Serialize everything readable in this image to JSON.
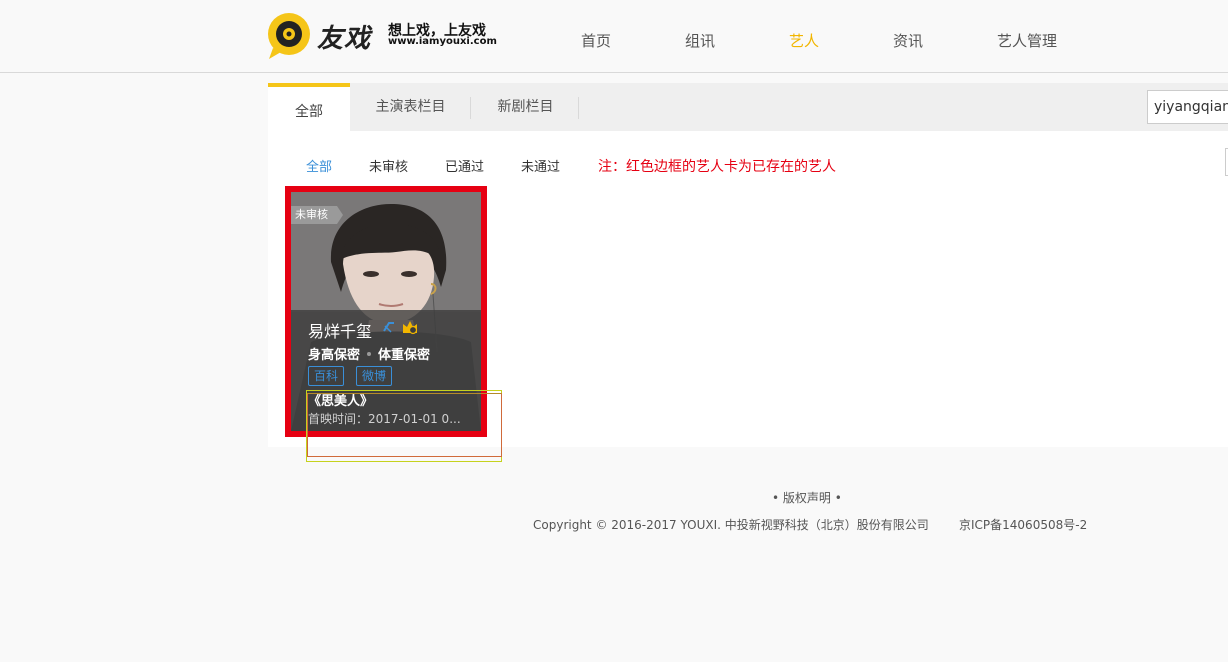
{
  "header": {
    "logo_text": "友戏",
    "logo_slogan": "想上戏，上友戏",
    "logo_url": "www.iamyouxi.com",
    "nav": [
      {
        "label": "首页"
      },
      {
        "label": "组讯"
      },
      {
        "label": "艺人",
        "active": true
      },
      {
        "label": "资讯"
      },
      {
        "label": "艺人管理"
      }
    ],
    "accent_color": "#f2b600"
  },
  "tabs": [
    {
      "label": "全部",
      "active": true
    },
    {
      "label": "主演表栏目"
    },
    {
      "label": "新剧栏目"
    }
  ],
  "search": {
    "value": "yiyangqianxi"
  },
  "filters": [
    {
      "label": "全部",
      "active": true
    },
    {
      "label": "未审核"
    },
    {
      "label": "已通过"
    },
    {
      "label": "未通过"
    }
  ],
  "note": "注：红色边框的艺人卡为已存在的艺人",
  "artist_card": {
    "status": "未审核",
    "name": "易烊千玺",
    "height": "身高保密",
    "weight": "体重保密",
    "links": [
      "百科",
      "微博"
    ],
    "works": "《思美人》",
    "premiere": "首映时间：2017-01-01 0...",
    "border_color": "#e60012",
    "icons": [
      "verified-icon",
      "crown-badge-icon"
    ]
  },
  "footer": {
    "link": "• 版权声明 •",
    "copyright": "Copyright © 2016-2017 YOUXI. 中投新视野科技（北京）股份有限公司",
    "icp": "京ICP备14060508号-2"
  }
}
